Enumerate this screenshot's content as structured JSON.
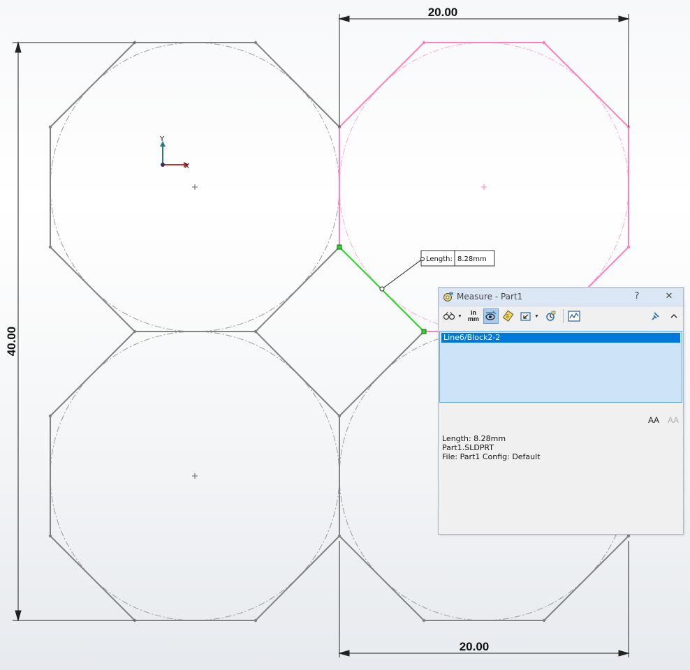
{
  "drawing": {
    "dimension_top": "20.00",
    "dimension_bottom": "20.00",
    "dimension_left": "40.00",
    "length_tag_label": "Length:",
    "length_tag_value": "8.28mm",
    "axis_x_label": "X",
    "axis_y_label": "Y"
  },
  "colors": {
    "sketch": "#828282",
    "selected_block": "#ff80c0",
    "measured_line": "#22dd22",
    "dialog_title_bg": "#dbe7f5",
    "list_bg": "#cce4f7",
    "list_selection": "#0078d7"
  },
  "dialog": {
    "title": "Measure - Part1",
    "help_label": "?",
    "close_label": "✕",
    "units_top": "in",
    "units_bottom": "mm",
    "selection_items": [
      "Line6/Block2-2"
    ],
    "font_increase_label": "AA",
    "font_decrease_label": "AA",
    "result_lines": [
      "Length: 8.28mm",
      "Part1.SLDPRT",
      "File: Part1 Config: Default"
    ],
    "toolbar_icons": [
      "arc-circle-measure-icon",
      "units-precision-icon",
      "show-xyz-icon",
      "point-to-point-icon",
      "projected-on-icon",
      "measurement-history-icon",
      "create-sensor-icon",
      "pin-icon",
      "collapse-icon"
    ]
  }
}
